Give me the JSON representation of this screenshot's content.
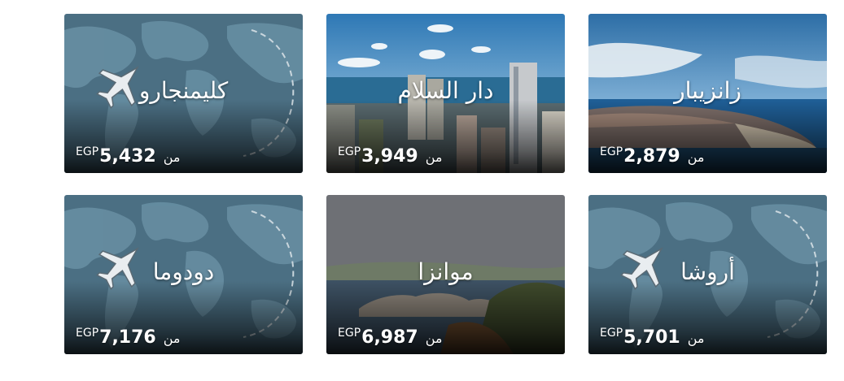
{
  "cards": [
    {
      "destination": "كليمنجارو",
      "from_label": "من",
      "amount": "5,432",
      "currency": "EGP",
      "image": "world-map"
    },
    {
      "destination": "دار السلام",
      "from_label": "من",
      "amount": "3,949",
      "currency": "EGP",
      "image": "city-skyline"
    },
    {
      "destination": "زانزيبار",
      "from_label": "من",
      "amount": "2,879",
      "currency": "EGP",
      "image": "island-coast"
    },
    {
      "destination": "دودوما",
      "from_label": "من",
      "amount": "7,176",
      "currency": "EGP",
      "image": "world-map"
    },
    {
      "destination": "موانزا",
      "from_label": "من",
      "amount": "6,987",
      "currency": "EGP",
      "image": "lake-rocks"
    },
    {
      "destination": "أروشا",
      "from_label": "من",
      "amount": "5,701",
      "currency": "EGP",
      "image": "world-map"
    }
  ],
  "icons": {
    "plane": "airplane-icon"
  },
  "colors": {
    "map_bg": "#4b6f83",
    "sky": "#2f6f9f",
    "gray": "#6d7076"
  }
}
